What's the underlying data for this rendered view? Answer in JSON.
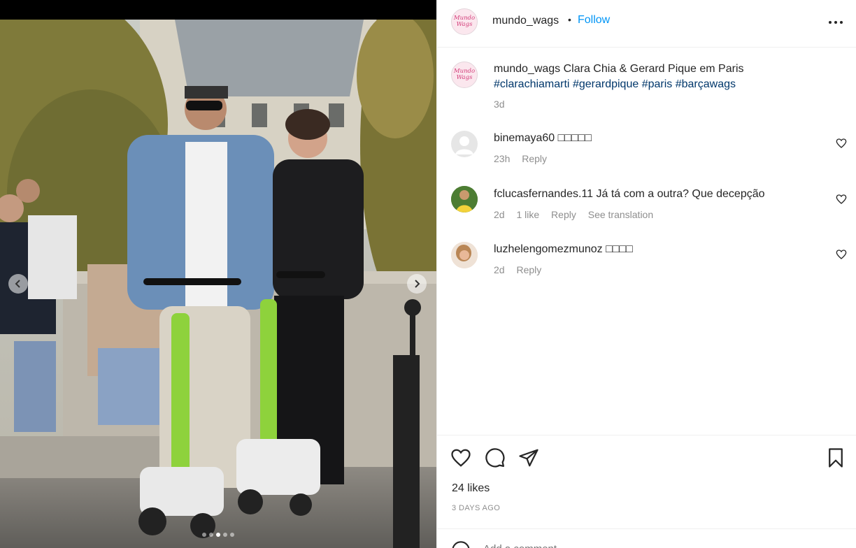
{
  "post": {
    "username": "mundo_wags",
    "separator": "•",
    "follow_label": "Follow",
    "avatar_text": "Mundo Wags",
    "caption": {
      "username": "mundo_wags",
      "text": "Clara Chia & Gerard Pique em Paris",
      "hashtags": [
        "#clarachiamarti",
        "#gerardpique",
        "#paris",
        "#barçawags"
      ],
      "time": "3d"
    },
    "likes": "24 likes",
    "time_ago": "3 DAYS AGO",
    "comment_placeholder": "Add a comment...",
    "carousel": {
      "count": 5,
      "active_index": 2
    }
  },
  "comments": [
    {
      "username": "binemaya60",
      "text": "□□□□□",
      "time": "23h",
      "likes": "",
      "reply": "Reply",
      "translation": ""
    },
    {
      "username": "fclucasfernandes.11",
      "text": "Já tá com a outra? Que decepção",
      "time": "2d",
      "likes": "1 like",
      "reply": "Reply",
      "translation": "See translation"
    },
    {
      "username": "luzhelengomezmunoz",
      "text": "□□□□",
      "time": "2d",
      "likes": "",
      "reply": "Reply",
      "translation": ""
    }
  ],
  "icons": {
    "more": "more-options-icon",
    "heart": "heart-icon",
    "comment": "comment-icon",
    "share": "share-icon",
    "save": "bookmark-icon",
    "prev": "chevron-left-icon",
    "next": "chevron-right-icon"
  },
  "colors": {
    "link": "#0095f6",
    "hashtag": "#00376b",
    "muted": "#8e8e8e",
    "text": "#262626"
  }
}
